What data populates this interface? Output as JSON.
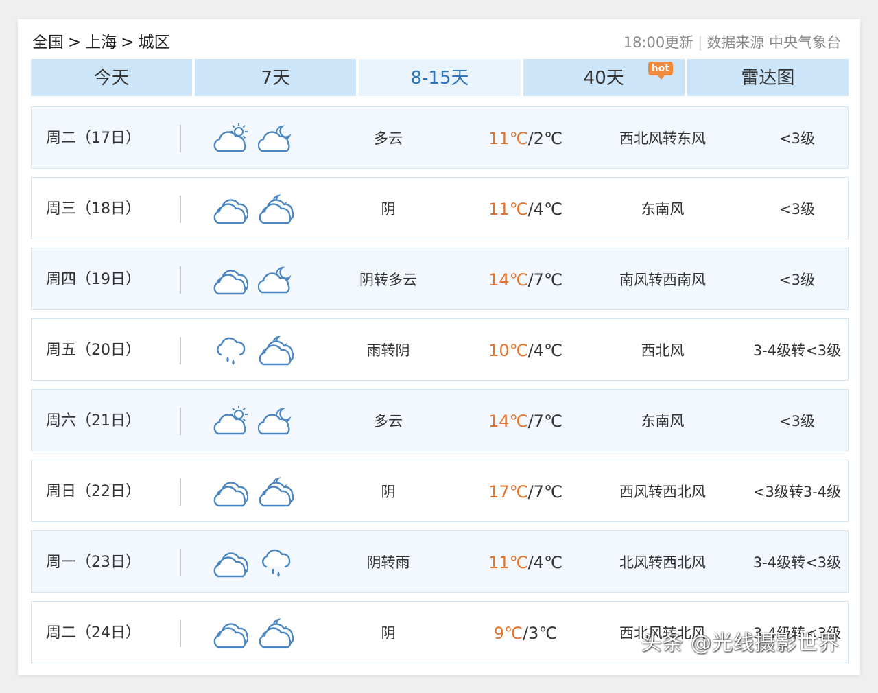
{
  "breadcrumb": {
    "country": "全国",
    "city": "上海",
    "district": "城区",
    "separator": ">"
  },
  "meta": {
    "update": "18:00更新",
    "source": "数据来源 中央气象台"
  },
  "tabs": [
    {
      "label": "今天"
    },
    {
      "label": "7天"
    },
    {
      "label": "8-15天",
      "active": true
    },
    {
      "label": "40天",
      "badge": "hot"
    },
    {
      "label": "雷达图"
    }
  ],
  "forecast": [
    {
      "day": "周二（17日）",
      "icon_day": "partly-cloudy-day-icon",
      "icon_night": "cloudy-night-moon-icon",
      "condition": "多云",
      "high": "11℃",
      "low": "2℃",
      "wind": "西北风转东风",
      "level": "<3级"
    },
    {
      "day": "周三（18日）",
      "icon_day": "overcast-icon",
      "icon_night": "overcast-night-icon",
      "condition": "阴",
      "high": "11℃",
      "low": "4℃",
      "wind": "东南风",
      "level": "<3级"
    },
    {
      "day": "周四（19日）",
      "icon_day": "overcast-icon",
      "icon_night": "cloudy-night-moon-icon",
      "condition": "阴转多云",
      "high": "14℃",
      "low": "7℃",
      "wind": "南风转西南风",
      "level": "<3级"
    },
    {
      "day": "周五（20日）",
      "icon_day": "rain-icon",
      "icon_night": "overcast-night-icon",
      "condition": "雨转阴",
      "high": "10℃",
      "low": "4℃",
      "wind": "西北风",
      "level": "3-4级转<3级"
    },
    {
      "day": "周六（21日）",
      "icon_day": "partly-cloudy-day-icon",
      "icon_night": "cloudy-night-moon-icon",
      "condition": "多云",
      "high": "14℃",
      "low": "7℃",
      "wind": "东南风",
      "level": "<3级"
    },
    {
      "day": "周日（22日）",
      "icon_day": "overcast-icon",
      "icon_night": "overcast-night-icon",
      "condition": "阴",
      "high": "17℃",
      "low": "7℃",
      "wind": "西风转西北风",
      "level": "<3级转3-4级"
    },
    {
      "day": "周一（23日）",
      "icon_day": "overcast-icon",
      "icon_night": "rain-icon",
      "condition": "阴转雨",
      "high": "11℃",
      "low": "4℃",
      "wind": "北风转西北风",
      "level": "3-4级转<3级"
    },
    {
      "day": "周二（24日）",
      "icon_day": "overcast-icon",
      "icon_night": "overcast-night-icon",
      "condition": "阴",
      "high": "9℃",
      "low": "3℃",
      "wind": "西北风转北风",
      "level": "3-4级转<3级"
    }
  ],
  "watermark": "头条 @光线摄影世界",
  "colors": {
    "tab_bg": "#cde5f8",
    "tab_active_text": "#2e73b8",
    "high_temp": "#e4742a",
    "icon_stroke": "#4b86c0",
    "hot_badge": "#f08a3c"
  }
}
